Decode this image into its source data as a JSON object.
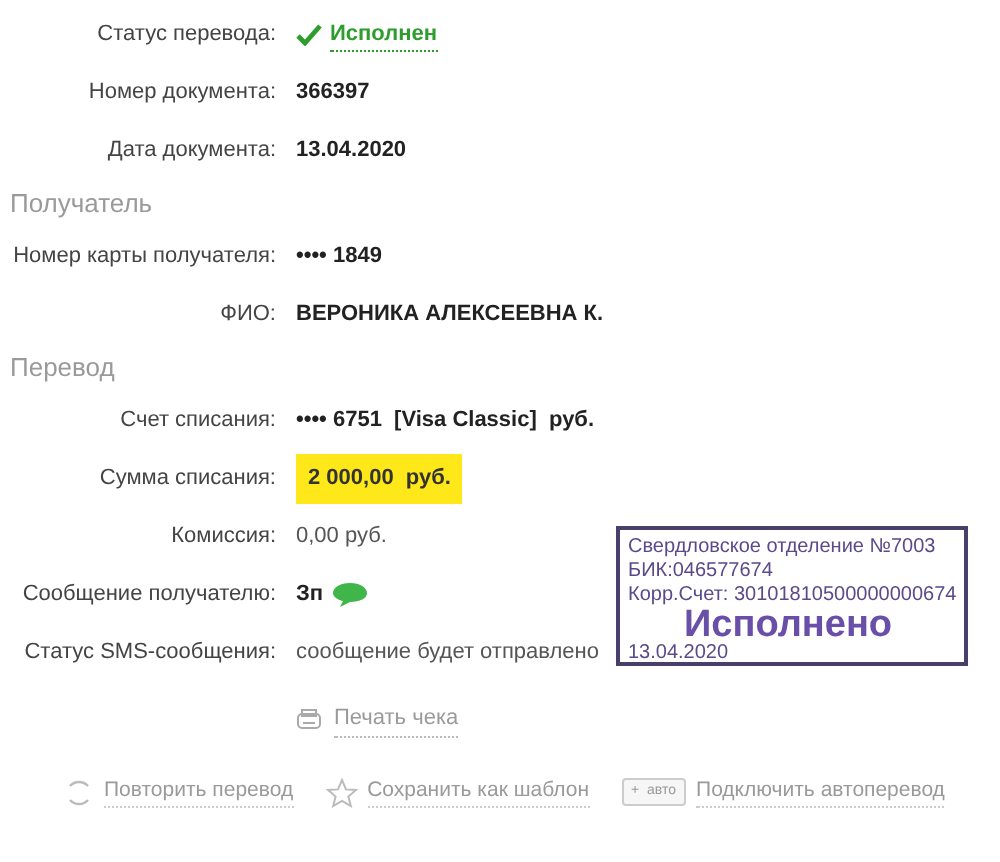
{
  "sections": [
    {
      "rows": [
        {
          "label": "Статус перевода:",
          "value": "Исполнен",
          "kind": "status"
        },
        {
          "label": "Номер документа:",
          "value": "366397",
          "kind": "bold"
        },
        {
          "label": "Дата документа:",
          "value": "13.04.2020",
          "kind": "bold"
        }
      ]
    },
    {
      "title": "Получатель",
      "rows": [
        {
          "label": "Номер карты получателя:",
          "value": "•••• 1849",
          "kind": "bold"
        },
        {
          "label": "ФИО:",
          "value": "ВЕРОНИКА АЛЕКСЕЕВНА К.",
          "kind": "bold"
        }
      ]
    },
    {
      "title": "Перевод",
      "rows": [
        {
          "label": "Счет списания:",
          "value": "•••• 6751  [Visa Classic]  руб.",
          "kind": "bold"
        },
        {
          "label": "Сумма списания:",
          "value": "2 000,00  руб.",
          "kind": "highlight"
        },
        {
          "label": "Комиссия:",
          "value": "0,00 руб.",
          "kind": "plain"
        },
        {
          "label": "Сообщение получателю:",
          "value": "Зп",
          "kind": "sms"
        },
        {
          "label": "Статус SMS-сообщения:",
          "value": "сообщение будет отправлено",
          "kind": "plain"
        }
      ]
    }
  ],
  "print_link": "Печать чека",
  "actions": [
    {
      "label": "Повторить перевод",
      "kind": "repeat"
    },
    {
      "label": "Сохранить как шаблон",
      "kind": "star"
    },
    {
      "label": "Подключить автоперевод",
      "kind": "auto",
      "badge": "+  авто"
    }
  ],
  "stamp": {
    "lines": [
      "Свердловское отделение №7003",
      "БИК:046577674",
      "Корр.Счет: 30101810500000000674"
    ],
    "status": "Исполнено",
    "date": "13.04.2020"
  }
}
